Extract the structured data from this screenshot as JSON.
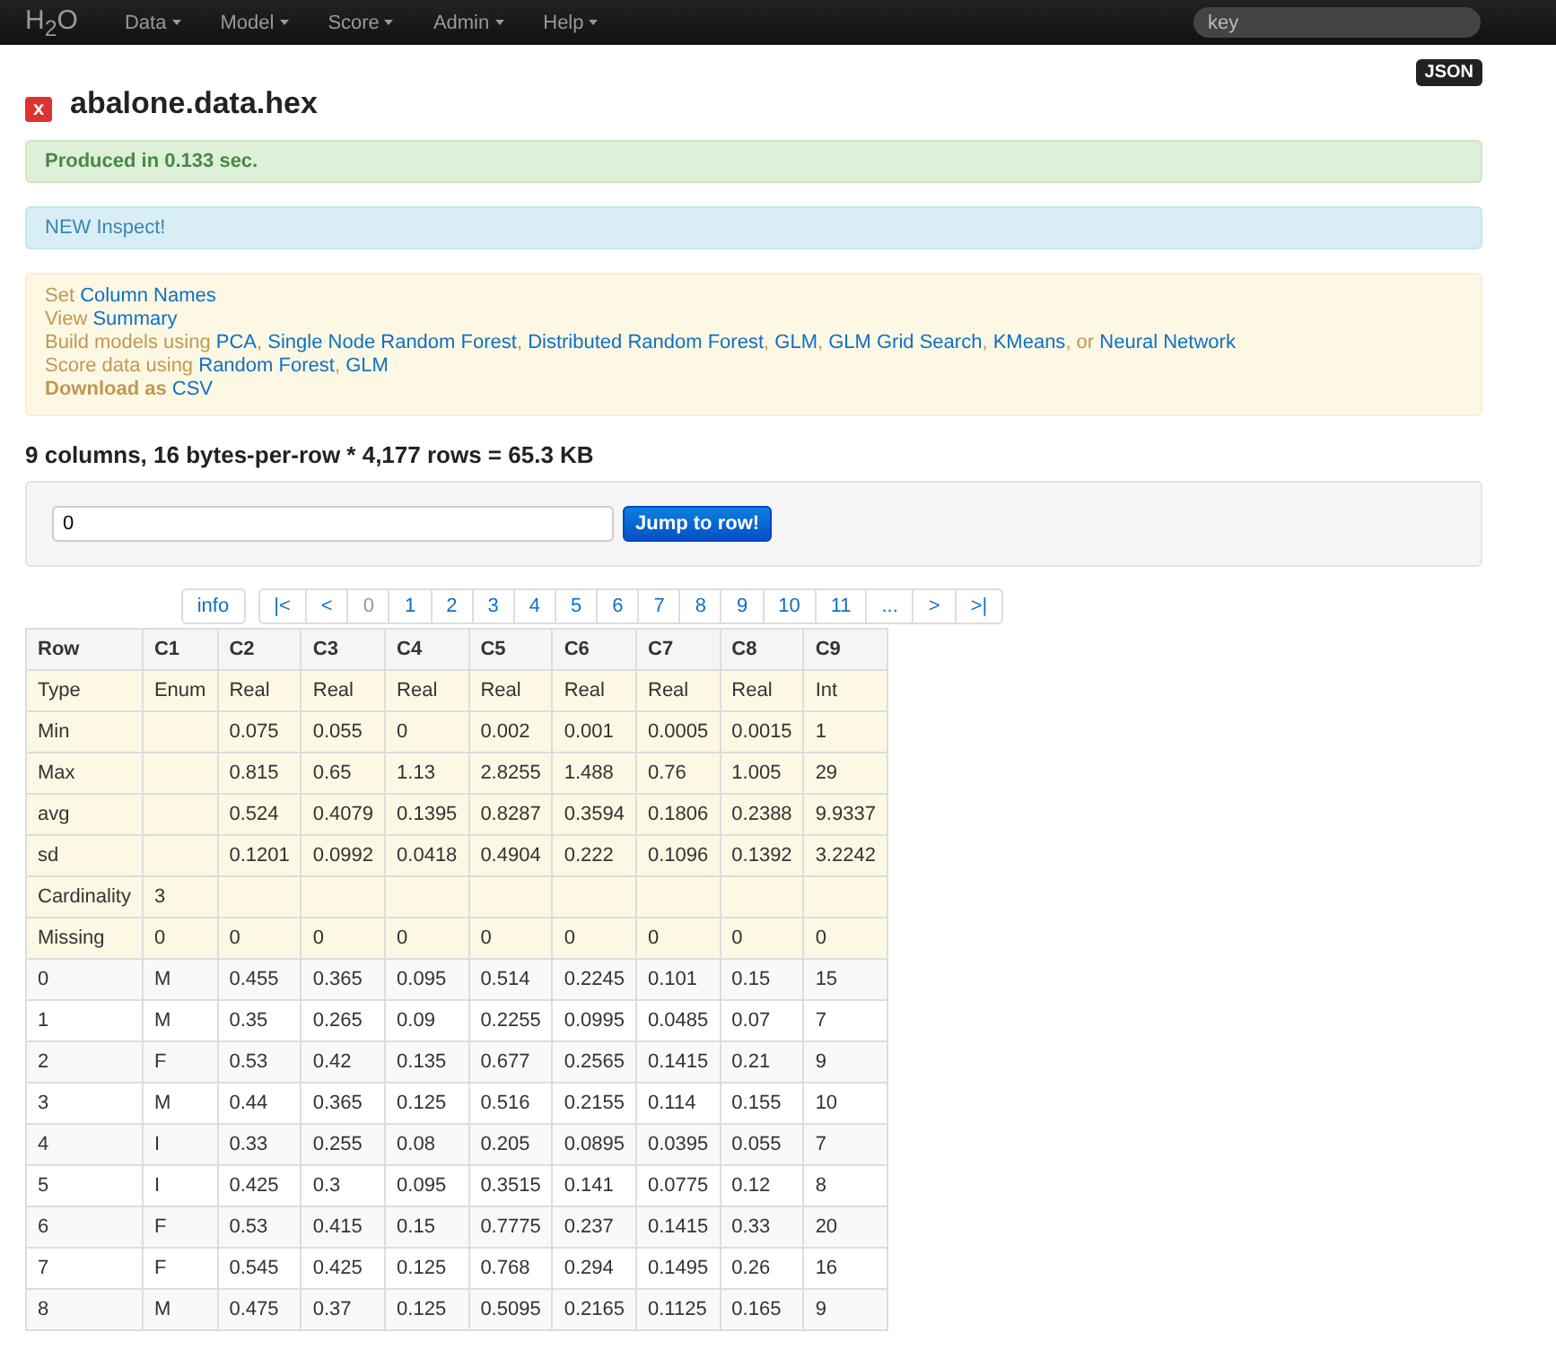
{
  "navbar": {
    "logo": "H$_{2}$O",
    "menus": [
      {
        "label": "Data"
      },
      {
        "label": "Model"
      },
      {
        "label": "Score"
      },
      {
        "label": "Admin"
      },
      {
        "label": "Help"
      }
    ],
    "search": {
      "placeholder": "key"
    }
  },
  "header": {
    "close": "x",
    "title": "abalone.data.hex",
    "json_button": "JSON"
  },
  "success_alert": "Produced in 0.133 sec.",
  "info_alert": "NEW Inspect!",
  "actions": [
    [
      {
        "kind": "text",
        "text": "Set "
      },
      {
        "kind": "link",
        "text": "Column Names"
      }
    ],
    [
      {
        "kind": "text",
        "text": "View "
      },
      {
        "kind": "link",
        "text": "Summary"
      }
    ],
    [
      {
        "kind": "text",
        "text": "Build models using "
      },
      {
        "kind": "link",
        "text": "PCA"
      },
      {
        "kind": "text",
        "text": ", "
      },
      {
        "kind": "link",
        "text": "Single Node Random Forest"
      },
      {
        "kind": "text",
        "text": ", "
      },
      {
        "kind": "link",
        "text": "Distributed Random Forest"
      },
      {
        "kind": "text",
        "text": ", "
      },
      {
        "kind": "link",
        "text": "GLM"
      },
      {
        "kind": "text",
        "text": ", "
      },
      {
        "kind": "link",
        "text": "GLM Grid Search"
      },
      {
        "kind": "text",
        "text": ", "
      },
      {
        "kind": "link",
        "text": "KMeans"
      },
      {
        "kind": "text",
        "text": ", or "
      },
      {
        "kind": "link",
        "text": "Neural Network"
      }
    ],
    [
      {
        "kind": "text",
        "text": "Score data using "
      },
      {
        "kind": "link",
        "text": "Random Forest"
      },
      {
        "kind": "text",
        "text": ", "
      },
      {
        "kind": "link",
        "text": "GLM"
      }
    ],
    [
      {
        "kind": "bold",
        "text": "Download as "
      },
      {
        "kind": "link",
        "text": "CSV"
      }
    ]
  ],
  "summary": "9 columns, 16 bytes-per-row * 4,177 rows = 65.3 KB",
  "jump": {
    "value": "0",
    "button": "Jump to row!"
  },
  "pagination": {
    "info": "info",
    "pages": [
      {
        "label": "|<",
        "selected": false
      },
      {
        "label": "<",
        "selected": false
      },
      {
        "label": "0",
        "selected": true
      },
      {
        "label": "1",
        "selected": false
      },
      {
        "label": "2",
        "selected": false
      },
      {
        "label": "3",
        "selected": false
      },
      {
        "label": "4",
        "selected": false
      },
      {
        "label": "5",
        "selected": false
      },
      {
        "label": "6",
        "selected": false
      },
      {
        "label": "7",
        "selected": false
      },
      {
        "label": "8",
        "selected": false
      },
      {
        "label": "9",
        "selected": false
      },
      {
        "label": "10",
        "selected": false
      },
      {
        "label": "11",
        "selected": false
      },
      {
        "label": "...",
        "selected": false
      },
      {
        "label": ">",
        "selected": false
      },
      {
        "label": ">|",
        "selected": false
      }
    ]
  },
  "table": {
    "columns": [
      "Row",
      "C1",
      "C2",
      "C3",
      "C4",
      "C5",
      "C6",
      "C7",
      "C8",
      "C9"
    ],
    "rows": [
      {
        "kind": "stat",
        "cells": [
          "Type",
          "Enum",
          "Real",
          "Real",
          "Real",
          "Real",
          "Real",
          "Real",
          "Real",
          "Int"
        ]
      },
      {
        "kind": "stat",
        "cells": [
          "Min",
          "",
          "0.075",
          "0.055",
          "0",
          "0.002",
          "0.001",
          "0.0005",
          "0.0015",
          "1"
        ]
      },
      {
        "kind": "stat",
        "cells": [
          "Max",
          "",
          "0.815",
          "0.65",
          "1.13",
          "2.8255",
          "1.488",
          "0.76",
          "1.005",
          "29"
        ]
      },
      {
        "kind": "stat",
        "cells": [
          "avg",
          "",
          "0.524",
          "0.4079",
          "0.1395",
          "0.8287",
          "0.3594",
          "0.1806",
          "0.2388",
          "9.9337"
        ]
      },
      {
        "kind": "stat",
        "cells": [
          "sd",
          "",
          "0.1201",
          "0.0992",
          "0.0418",
          "0.4904",
          "0.222",
          "0.1096",
          "0.1392",
          "3.2242"
        ]
      },
      {
        "kind": "stat",
        "cells": [
          "Cardinality",
          "3",
          "",
          "",
          "",
          "",
          "",
          "",
          "",
          ""
        ]
      },
      {
        "kind": "stat",
        "cells": [
          "Missing",
          "0",
          "0",
          "0",
          "0",
          "0",
          "0",
          "0",
          "0",
          "0"
        ]
      },
      {
        "kind": "data",
        "cells": [
          "0",
          "M",
          "0.455",
          "0.365",
          "0.095",
          "0.514",
          "0.2245",
          "0.101",
          "0.15",
          "15"
        ]
      },
      {
        "kind": "data",
        "cells": [
          "1",
          "M",
          "0.35",
          "0.265",
          "0.09",
          "0.2255",
          "0.0995",
          "0.0485",
          "0.07",
          "7"
        ]
      },
      {
        "kind": "data",
        "cells": [
          "2",
          "F",
          "0.53",
          "0.42",
          "0.135",
          "0.677",
          "0.2565",
          "0.1415",
          "0.21",
          "9"
        ]
      },
      {
        "kind": "data",
        "cells": [
          "3",
          "M",
          "0.44",
          "0.365",
          "0.125",
          "0.516",
          "0.2155",
          "0.114",
          "0.155",
          "10"
        ]
      },
      {
        "kind": "data",
        "cells": [
          "4",
          "I",
          "0.33",
          "0.255",
          "0.08",
          "0.205",
          "0.0895",
          "0.0395",
          "0.055",
          "7"
        ]
      },
      {
        "kind": "data",
        "cells": [
          "5",
          "I",
          "0.425",
          "0.3",
          "0.095",
          "0.3515",
          "0.141",
          "0.0775",
          "0.12",
          "8"
        ]
      },
      {
        "kind": "data",
        "cells": [
          "6",
          "F",
          "0.53",
          "0.415",
          "0.15",
          "0.7775",
          "0.237",
          "0.1415",
          "0.33",
          "20"
        ]
      },
      {
        "kind": "data",
        "cells": [
          "7",
          "F",
          "0.545",
          "0.425",
          "0.125",
          "0.768",
          "0.294",
          "0.1495",
          "0.26",
          "16"
        ]
      },
      {
        "kind": "data",
        "cells": [
          "8",
          "M",
          "0.475",
          "0.37",
          "0.125",
          "0.5095",
          "0.2165",
          "0.1125",
          "0.165",
          "9"
        ]
      }
    ]
  }
}
